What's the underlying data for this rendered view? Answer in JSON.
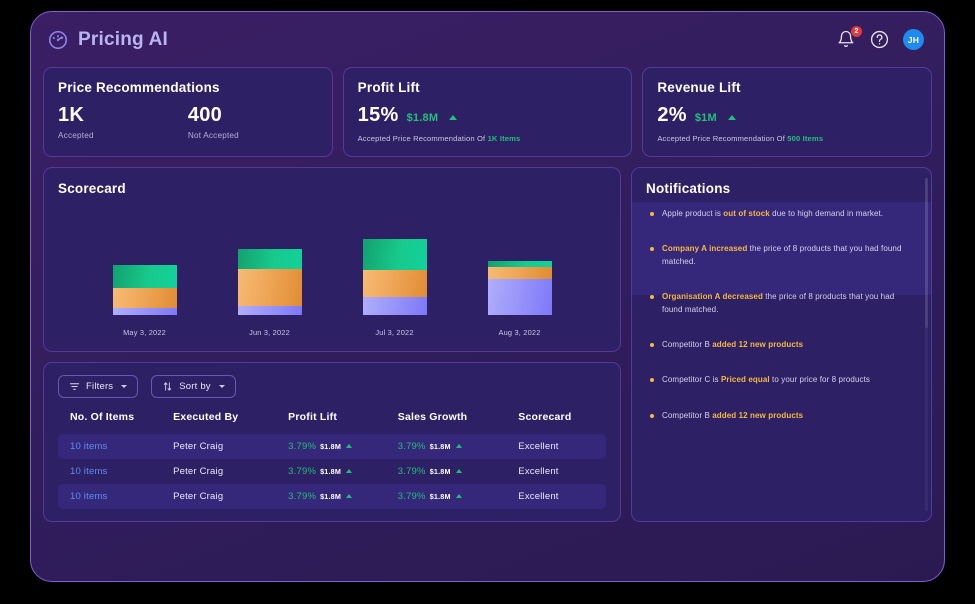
{
  "header": {
    "brand": "Pricing AI",
    "logo_icon": "gauge-icon",
    "notification_icon": "bell-icon",
    "notification_count": "2",
    "help_icon": "help-circle-icon",
    "avatar_initials": "JH"
  },
  "kpis": [
    {
      "title": "Price Recommendations",
      "left_value": "1K",
      "left_label": "Accepted",
      "right_value": "400",
      "right_label": "Not Accepted"
    },
    {
      "title": "Profit Lift",
      "value": "15%",
      "money": "$1.8M",
      "trend_icon": "trend-up-icon",
      "footer_prefix": "Accepted Price Recommendation Of ",
      "footer_highlight": "1K Items"
    },
    {
      "title": "Revenue Lift",
      "value": "2%",
      "money": "$1M",
      "trend_icon": "trend-up-icon",
      "footer_prefix": "Accepted Price Recommendation Of ",
      "footer_highlight": "500 Items"
    }
  ],
  "scorecard": {
    "title": "Scorecard"
  },
  "chart_data": {
    "type": "bar",
    "title": "Scorecard",
    "stacked": true,
    "categories": [
      "May 3, 2022",
      "Jun 3, 2022",
      "Jul 3, 2022",
      "Aug 3, 2022"
    ],
    "series": [
      {
        "name": "purple",
        "color": "#9a96fa",
        "values": [
          6,
          8,
          16,
          32
        ]
      },
      {
        "name": "orange",
        "color": "#f0a95b",
        "values": [
          18,
          33,
          24,
          10
        ]
      },
      {
        "name": "green",
        "color": "#18c98c",
        "values": [
          20,
          17,
          27,
          6
        ]
      }
    ],
    "totals": [
      44,
      58,
      67,
      48
    ],
    "ylim": [
      0,
      75
    ],
    "grid": false,
    "legend": "none",
    "xlabel": "",
    "ylabel": ""
  },
  "table": {
    "filters_label": "Filters",
    "filters_icon": "filter-icon",
    "sort_label": "Sort by",
    "sort_icon": "sort-icon",
    "chevron_icon": "chevron-down-icon",
    "columns": [
      "No. Of Items",
      "Executed By",
      "Profit Lift",
      "Sales Growth",
      "Scorecard"
    ],
    "rows": [
      {
        "items": "10 items",
        "executed_by": "Peter Craig",
        "profit_pct": "3.79%",
        "profit_amt": "$1.8M",
        "sales_pct": "3.79%",
        "sales_amt": "$1.8M",
        "scorecard": "Excellent"
      },
      {
        "items": "10 items",
        "executed_by": "Peter Craig",
        "profit_pct": "3.79%",
        "profit_amt": "$1.8M",
        "sales_pct": "3.79%",
        "sales_amt": "$1.8M",
        "scorecard": "Excellent"
      },
      {
        "items": "10 items",
        "executed_by": "Peter Craig",
        "profit_pct": "3.79%",
        "profit_amt": "$1.8M",
        "sales_pct": "3.79%",
        "sales_amt": "$1.8M",
        "scorecard": "Excellent"
      }
    ]
  },
  "notifications": {
    "title": "Notifications",
    "items": [
      {
        "pre": "Apple product is ",
        "hl": "out of stock",
        "post": " due to high demand in market."
      },
      {
        "pre": "",
        "hl": "Company A increased",
        "post": " the price of 8 products that you had found matched."
      },
      {
        "pre": "",
        "hl": "Organisation A decreased",
        "post": " the price of 8 products that you had found matched."
      },
      {
        "pre": "Competitor B ",
        "hl": "added 12 new products",
        "post": ""
      },
      {
        "pre": "Competitor C is ",
        "hl": "Priced equal",
        "post": " to your price for 8 products"
      },
      {
        "pre": "Competitor B ",
        "hl": "added 12 new products",
        "post": ""
      }
    ]
  },
  "colors": {
    "accent_green": "#22c07a",
    "accent_yellow": "#f5b942",
    "accent_blue": "#5d8ef0",
    "badge_red": "#e0393e",
    "avatar_blue": "#1f8af0",
    "card_bg": "#2e2064",
    "card_border": "#54399b"
  }
}
